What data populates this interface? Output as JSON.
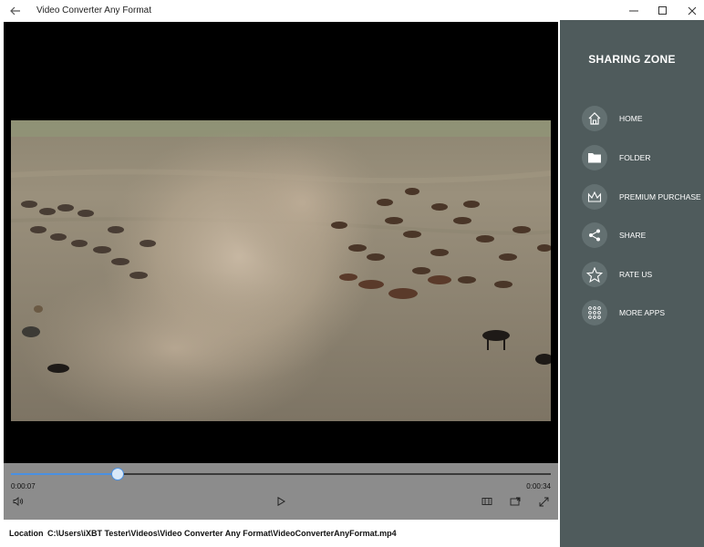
{
  "window": {
    "title": "Video Converter Any Format"
  },
  "player": {
    "current_time": "0:00:07",
    "total_time": "0:00:34",
    "progress": 0.198
  },
  "location": {
    "label": "Location",
    "path": "C:\\Users\\iXBT Tester\\Videos\\Video Converter Any Format\\VideoConverterAnyFormat.mp4"
  },
  "sidebar": {
    "title": "SHARING ZONE",
    "items": [
      {
        "label": "HOME",
        "icon": "home-icon"
      },
      {
        "label": "FOLDER",
        "icon": "folder-icon"
      },
      {
        "label": "PREMIUM PURCHASE",
        "icon": "crown-icon"
      },
      {
        "label": "SHARE",
        "icon": "share-icon"
      },
      {
        "label": "RATE US",
        "icon": "star-icon"
      },
      {
        "label": "MORE APPS",
        "icon": "grid-dots-icon"
      }
    ]
  },
  "colors": {
    "sidebar_bg": "#4f5b5c",
    "player_bg": "#8c8c8c",
    "seek_fill": "#4a90e2"
  }
}
